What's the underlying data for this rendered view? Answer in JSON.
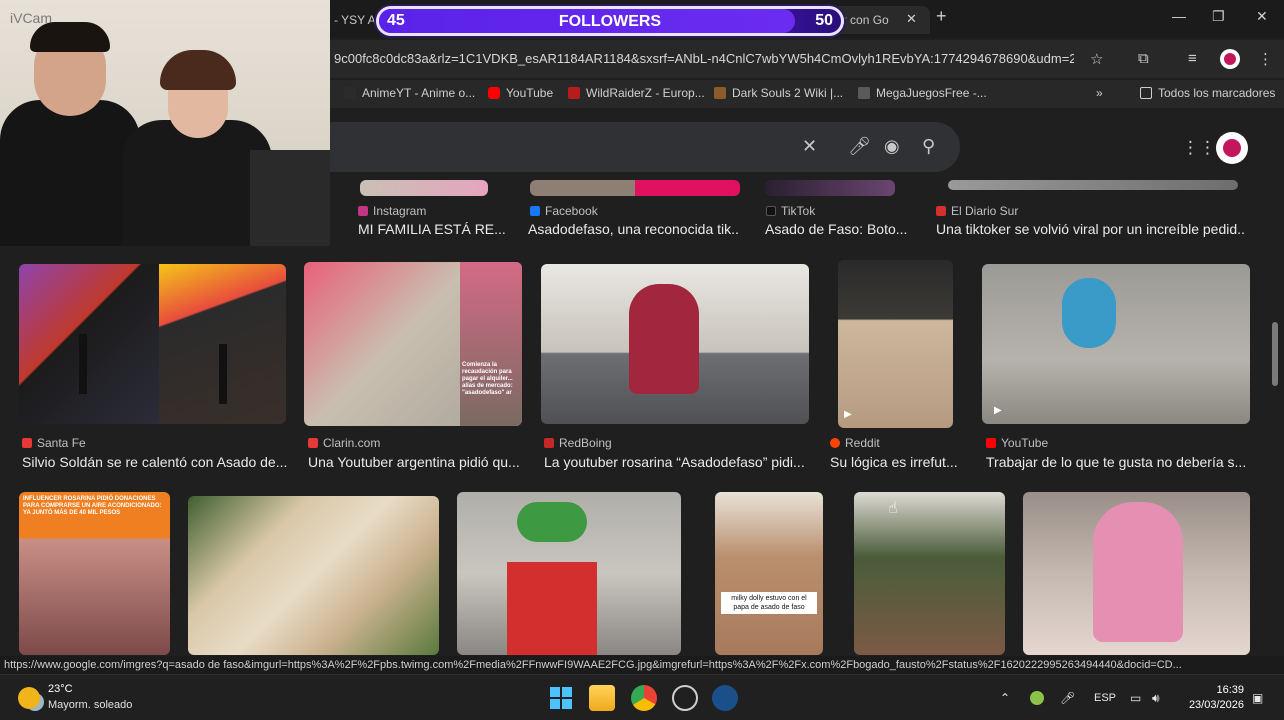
{
  "browser": {
    "tab_left": "- YSY A",
    "tab_active": "aso - ...ar con Go",
    "url": "9c00fc8c0dc83a&rlz=1C1VDKB_esAR1184AR1184&sxsrf=ANbL-n4CnlC7wbYW5h4CmOvlyh1REvbYA:1774294678690&udm=2...",
    "bookmarks": [
      {
        "label": "AnimeYT - Anime o...",
        "icon_color": "#2b2b2b"
      },
      {
        "label": "YouTube",
        "icon_color": "#ff0000"
      },
      {
        "label": "WildRaiderZ - Europ...",
        "icon_color": "#b71c1c"
      },
      {
        "label": "Dark Souls 2 Wiki |...",
        "icon_color": "#8d5a2b"
      },
      {
        "label": "MegaJuegosFree -...",
        "icon_color": "#5a5a5a"
      }
    ],
    "all_bookmarks": "Todos los marcadores",
    "status_url": "https://www.google.com/imgres?q=asado de faso&imgurl=https%3A%2F%2Fpbs.twimg.com%2Fmedia%2FFnwwFI9WAAE2FCG.jpg&imgrefurl=https%3A%2F%2Fx.com%2Fbogado_fausto%2Fstatus%2F1620222995263494440&docid=CD..."
  },
  "followers_overlay": {
    "current": "45",
    "label": "FOLLOWERS",
    "goal": "50",
    "progress": 0.9
  },
  "webcam": {
    "label": "iVCam"
  },
  "results_row0": [
    {
      "source": "Instagram",
      "title": "MI FAMILIA ESTÁ RE...",
      "fav_color": "#c13584"
    },
    {
      "source": "Facebook",
      "title": "Asadodefaso, una reconocida tik...",
      "fav_color": "#1877f2"
    },
    {
      "source": "TikTok",
      "title": "Asado de Faso: Boto...",
      "fav_color": "#111111"
    },
    {
      "source": "El Diario Sur",
      "title": "Una tiktoker se volvió viral por un increíble pedid...",
      "fav_color": "#d32f2f"
    }
  ],
  "results_row1": [
    {
      "source": "Santa Fe",
      "title": "Silvio Soldán se re calentó con Asado de...",
      "fav_color": "#e53935"
    },
    {
      "source": "Clarin.com",
      "title": "Una Youtuber argentina pidió qu...",
      "fav_color": "#e53935"
    },
    {
      "source": "RedBoing",
      "title": "La youtuber rosarina “Asadodefaso” pidi...",
      "fav_color": "#c62828"
    },
    {
      "source": "Reddit",
      "title": "Su lógica es irrefut...",
      "fav_color": "#ff4500"
    },
    {
      "source": "YouTube",
      "title": "Trabajar de lo que te gusta no debería s...",
      "fav_color": "#ff0000"
    }
  ],
  "thumb_texts": {
    "clarin_caption": "Comienza la recaudación para pagar el alquiler... alias de mercado: \"asadodefaso\" ar",
    "insta_banner": "INFLUENCER ROSARINA PIDIÓ DONACIONES PARA COMPRARSE UN AIRE ACONDICIONADO: YA JUNTÓ MÁS DE 40 MIL PESOS",
    "milky_caption": "milky dolly estuvo con el papa de asado de faso"
  },
  "taskbar": {
    "temp": "23°C",
    "condition": "Mayorm. soleado",
    "lang": "ESP",
    "time": "16:39",
    "date": "23/03/2026"
  }
}
